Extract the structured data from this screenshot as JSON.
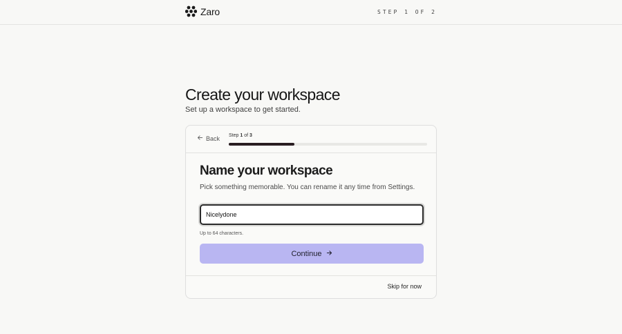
{
  "brand": {
    "name": "Zaro",
    "icon": "flower-logo-icon"
  },
  "header": {
    "step_indicator": "STEP 1 OF 2"
  },
  "page": {
    "title": "Create your workspace",
    "subtitle": "Set up a workspace to get started."
  },
  "card": {
    "back_label": "Back",
    "progress": {
      "prefix": "Step",
      "current": "1",
      "separator": "of",
      "total": "3",
      "fraction": 0.33
    },
    "section_title": "Name your workspace",
    "section_desc": "Pick something memorable. You can rename it any time from Settings.",
    "input": {
      "value": "Nicelydone",
      "placeholder": ""
    },
    "helper": "Up to 64 characters.",
    "continue_label": "Continue",
    "skip_label": "Skip for now"
  },
  "colors": {
    "accent_button": "#b9b6f2",
    "progress_fill": "#2a1e22",
    "background": "#f8f8f6"
  }
}
